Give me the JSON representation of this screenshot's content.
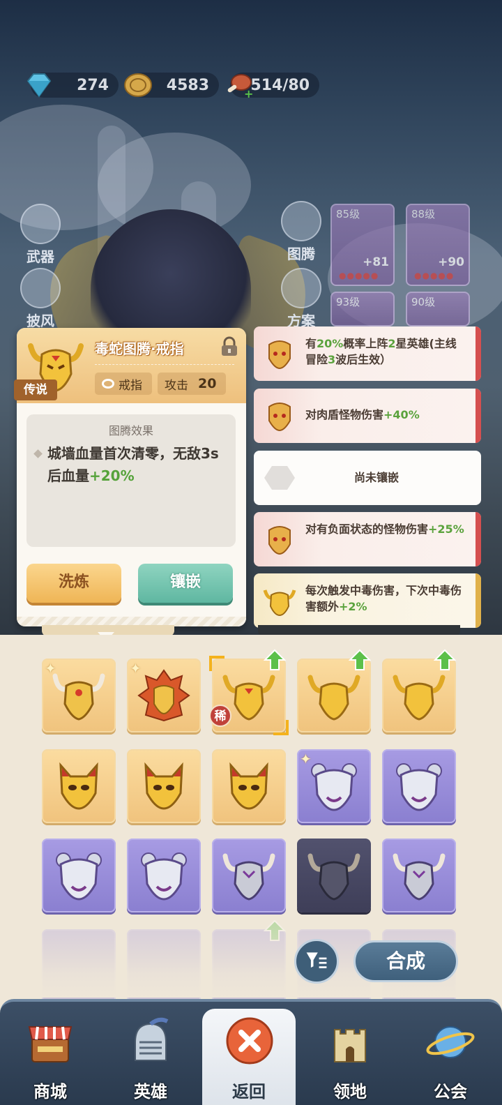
{
  "resources": [
    {
      "icon": "diamond-icon",
      "value": "274"
    },
    {
      "icon": "coin-icon",
      "value": "4583"
    },
    {
      "icon": "meat-icon",
      "value": "514/80"
    }
  ],
  "side_menu": {
    "weapon": "武器",
    "cloak": "披风",
    "totem": "图腾",
    "plan": "方案"
  },
  "top_cards": [
    {
      "level": "85级",
      "plus": "+81"
    },
    {
      "level": "88级",
      "plus": "+90"
    },
    {
      "level": "93级",
      "plus": ""
    },
    {
      "level": "90级",
      "plus": ""
    }
  ],
  "detail": {
    "title": "毒蛇图腾·戒指",
    "rarity": "传说",
    "slot_type": "戒指",
    "stat_label": "攻击",
    "stat_value": "20",
    "effect_header": "图腾效果",
    "effect_text_a": "城墙血量首次清零，无敌3s后血量",
    "effect_text_b": "+20%",
    "wash_button": "洗炼",
    "inlay_button": "镶嵌"
  },
  "affixes": [
    {
      "pre": "有",
      "g1": "20%",
      "mid": "概率上阵",
      "g2": "2",
      "mid2": "星英雄(主线冒险",
      "g3": "3",
      "post": "波后生效）",
      "style": "pink"
    },
    {
      "pre": "对肉盾怪物伤害",
      "g1": "+40%",
      "style": "pink"
    },
    {
      "text": "尚未镶嵌",
      "style": "empty"
    },
    {
      "pre": "对有负面状态的怪物伤害",
      "g1": "+25%",
      "style": "pink"
    },
    {
      "pre": "每次触发中毒伤害，下次中毒伤害额外",
      "g1": "+2%",
      "style": "gold"
    }
  ],
  "inventory": {
    "rare_label": "稀",
    "filter_icon": "filter-icon",
    "merge_button": "合成"
  },
  "nav": [
    {
      "label": "商城",
      "icon": "shop-icon"
    },
    {
      "label": "英雄",
      "icon": "helmet-icon"
    },
    {
      "label": "返回",
      "icon": "close-icon"
    },
    {
      "label": "领地",
      "icon": "castle-icon"
    },
    {
      "label": "公会",
      "icon": "planet-icon"
    }
  ],
  "colors": {
    "legend_gold": "#eec07d",
    "rare_purple": "#8a7fd0",
    "bonus_green": "#55a23a",
    "accent_red": "#d54f4f"
  }
}
